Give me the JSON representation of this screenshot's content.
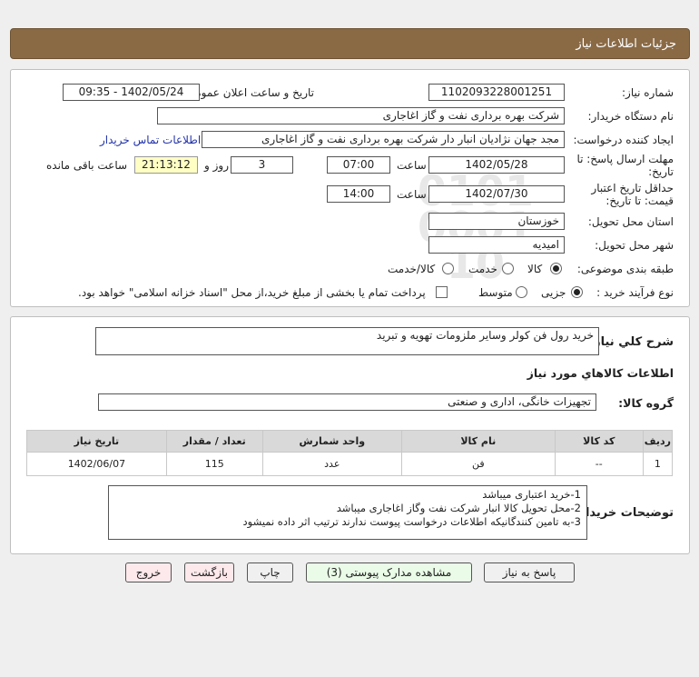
{
  "header": {
    "title": "جزئیات اطلاعات نیاز"
  },
  "form": {
    "need_number_label": "شماره نیاز:",
    "need_number": "1102093228001251",
    "announce_label": "تاریخ و ساعت اعلان عمومی:",
    "announce_value": "1402/05/24 - 09:35",
    "buyer_org_label": "نام دستگاه خریدار:",
    "buyer_org": "شرکت بهره برداری نفت و گاز اغاجاری",
    "creator_label": "ایجاد کننده درخواست:",
    "creator": "مجد جهان نژادیان انبار دار شرکت بهره برداری نفت و گاز اغاجاری",
    "contact_link": "اطلاعات تماس خریدار",
    "reply_deadline_label_1": "مهلت ارسال پاسخ: تا",
    "reply_deadline_label_2": "تاریخ:",
    "reply_date": "1402/05/28",
    "time_label": "ساعت",
    "reply_time": "07:00",
    "days_value": "3",
    "days_label": "روز و",
    "remaining_time": "21:13:12",
    "remaining_label": "ساعت باقی مانده",
    "validity_label_1": "حداقل تاریخ اعتبار",
    "validity_label_2": "قیمت: تا تاریخ:",
    "validity_date": "1402/07/30",
    "validity_time_label": "ساعت",
    "validity_time": "14:00",
    "province_label": "استان محل تحویل:",
    "province": "خوزستان",
    "city_label": "شهر محل تحویل:",
    "city": "امیدیه",
    "category_label": "طبقه بندی موضوعی:",
    "category_options": [
      "کالا",
      "خدمت",
      "کالا/خدمت"
    ],
    "process_label": "نوع فرآیند خرید :",
    "process_options": [
      "جزیی",
      "متوسط"
    ],
    "payment_note": "پرداخت تمام یا بخشی از مبلغ خرید،از محل \"اسناد خزانه اسلامی\" خواهد بود."
  },
  "summary": {
    "label": "شرح کلي نياز:",
    "value": "خرید رول فن کولر وسایر ملزومات تهویه و تبرید"
  },
  "goods_section_title": "اطلاعات کالاهاي مورد نياز",
  "goods_group": {
    "label": "گروه کالا:",
    "value": "تجهیزات خانگی، اداری و صنعتی"
  },
  "table": {
    "headers": [
      "ردیف",
      "کد کالا",
      "نام کالا",
      "واحد شمارش",
      "تعداد / مقدار",
      "تاریخ نیاز"
    ],
    "rows": [
      [
        "1",
        "--",
        "فن",
        "عدد",
        "115",
        "1402/06/07"
      ]
    ]
  },
  "notes": {
    "label": "توضیحات خریدار:",
    "lines": [
      "1-خرید اعتباری میباشد",
      "2-محل تحویل کالا انبار شرکت نفت وگاز اغاجاری میباشد",
      "3-به تامین کنندگانیکه  اطلاعات درخواست پیوست ندارند ترتیب اثر داده نمیشود"
    ]
  },
  "buttons": {
    "reply": "پاسخ به نیاز",
    "attachments": "مشاهده مدارک پیوستی (3)",
    "print": "چاپ",
    "back": "بازگشت",
    "exit": "خروج"
  }
}
